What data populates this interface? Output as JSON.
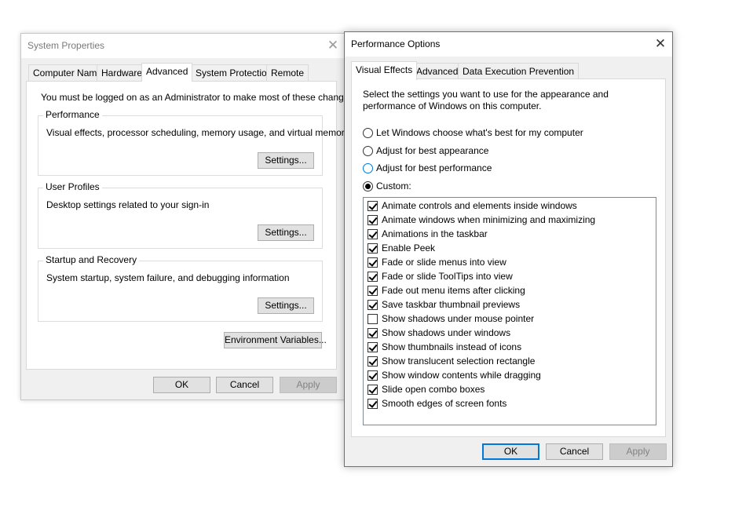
{
  "system_properties": {
    "title": "System Properties",
    "close_glyph": "✕",
    "tabs": [
      {
        "label": "Computer Name"
      },
      {
        "label": "Hardware"
      },
      {
        "label": "Advanced"
      },
      {
        "label": "System Protection"
      },
      {
        "label": "Remote"
      }
    ],
    "active_tab": "Advanced",
    "admin_note": "You must be logged on as an Administrator to make most of these changes.",
    "groups": [
      {
        "label": "Performance",
        "text": "Visual effects, processor scheduling, memory usage, and virtual memory",
        "button": "Settings..."
      },
      {
        "label": "User Profiles",
        "text": "Desktop settings related to your sign-in",
        "button": "Settings..."
      },
      {
        "label": "Startup and Recovery",
        "text": "System startup, system failure, and debugging information",
        "button": "Settings..."
      }
    ],
    "env_button": "Environment Variables...",
    "buttons": {
      "ok": "OK",
      "cancel": "Cancel",
      "apply": "Apply"
    }
  },
  "performance_options": {
    "title": "Performance Options",
    "close_glyph": "✕",
    "tabs": [
      {
        "label": "Visual Effects"
      },
      {
        "label": "Advanced"
      },
      {
        "label": "Data Execution Prevention"
      }
    ],
    "active_tab": "Visual Effects",
    "description": "Select the settings you want to use for the appearance and performance of Windows on this computer.",
    "radio_options": [
      {
        "label": "Let Windows choose what's best for my computer",
        "selected": false
      },
      {
        "label": "Adjust for best appearance",
        "selected": false
      },
      {
        "label": "Adjust for best performance",
        "selected": false
      },
      {
        "label": "Custom:",
        "selected": true
      }
    ],
    "effects": [
      {
        "label": "Animate controls and elements inside windows",
        "checked": true
      },
      {
        "label": "Animate windows when minimizing and maximizing",
        "checked": true
      },
      {
        "label": "Animations in the taskbar",
        "checked": true
      },
      {
        "label": "Enable Peek",
        "checked": true
      },
      {
        "label": "Fade or slide menus into view",
        "checked": true
      },
      {
        "label": "Fade or slide ToolTips into view",
        "checked": true
      },
      {
        "label": "Fade out menu items after clicking",
        "checked": true
      },
      {
        "label": "Save taskbar thumbnail previews",
        "checked": true
      },
      {
        "label": "Show shadows under mouse pointer",
        "checked": false
      },
      {
        "label": "Show shadows under windows",
        "checked": true
      },
      {
        "label": "Show thumbnails instead of icons",
        "checked": true
      },
      {
        "label": "Show translucent selection rectangle",
        "checked": true
      },
      {
        "label": "Show window contents while dragging",
        "checked": true
      },
      {
        "label": "Slide open combo boxes",
        "checked": true
      },
      {
        "label": "Smooth edges of screen fonts",
        "checked": true
      }
    ],
    "buttons": {
      "ok": "OK",
      "cancel": "Cancel",
      "apply": "Apply"
    }
  }
}
